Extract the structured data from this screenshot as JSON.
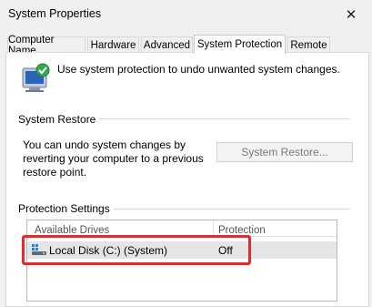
{
  "window": {
    "title": "System Properties",
    "close_glyph": "✕"
  },
  "tabs": [
    {
      "label": "Computer Name",
      "active": false
    },
    {
      "label": "Hardware",
      "active": false
    },
    {
      "label": "Advanced",
      "active": false
    },
    {
      "label": "System Protection",
      "active": true
    },
    {
      "label": "Remote",
      "active": false
    }
  ],
  "intro_text": "Use system protection to undo unwanted system changes.",
  "system_restore": {
    "group_label": "System Restore",
    "description": "You can undo system changes by reverting your computer to a previous restore point.",
    "button_label": "System Restore..."
  },
  "protection_settings": {
    "group_label": "Protection Settings",
    "columns": [
      "Available Drives",
      "Protection"
    ],
    "drives": [
      {
        "name": "Local Disk (C:) (System)",
        "protection": "Off",
        "icon": "drive-icon"
      }
    ]
  },
  "colors": {
    "highlight": "#e8282b",
    "selected_row": "#e5e5e5",
    "panel_bg": "#ffffff",
    "window_bg": "#f0f0f0"
  }
}
